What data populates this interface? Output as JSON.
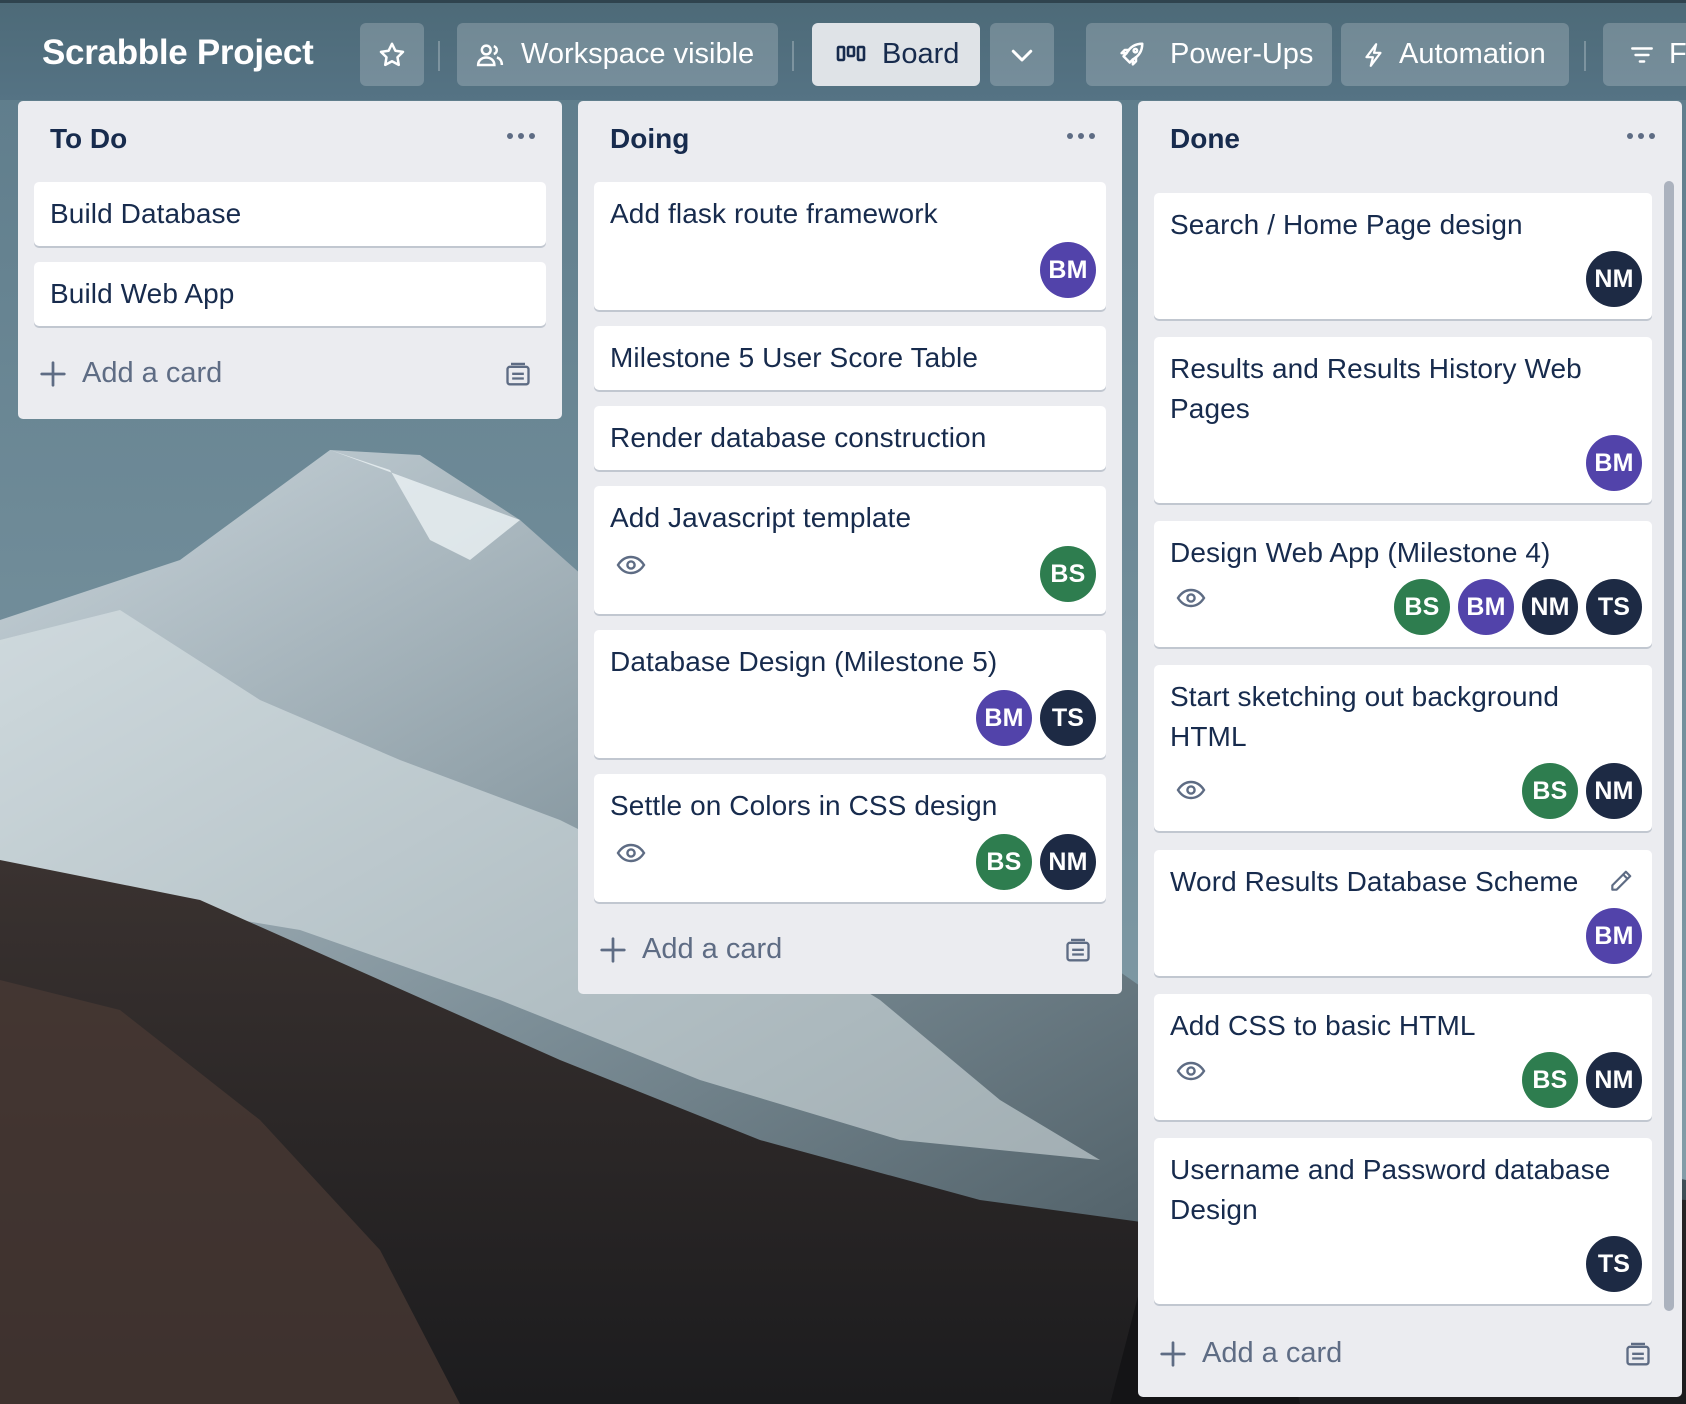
{
  "board": {
    "title": "Scrabble Project",
    "visibility_label": "Workspace visible",
    "view_label": "Board",
    "powerups_label": "Power-Ups",
    "automation_label": "Automation",
    "filter_label_partial": "F"
  },
  "colors": {
    "header_bg": "#557384",
    "list_bg": "#ebecf0",
    "card_bg": "#ffffff",
    "text_primary": "#172b4d",
    "text_muted": "#5e6c84",
    "avatar_BM": "#5243aa",
    "avatar_BS": "#2e7d4f",
    "avatar_NM": "#1d2a44",
    "avatar_TS": "#1d2a44"
  },
  "lists": [
    {
      "title": "To Do",
      "add_card_label": "Add a card",
      "cards": [
        {
          "title": "Build Database"
        },
        {
          "title": "Build Web App"
        }
      ]
    },
    {
      "title": "Doing",
      "add_card_label": "Add a card",
      "cards": [
        {
          "title": "Add flask route framework",
          "members": [
            "BM"
          ]
        },
        {
          "title": "Milestone 5 User Score Table"
        },
        {
          "title": "Render database construction"
        },
        {
          "title": "Add Javascript template",
          "watching": true,
          "members": [
            "BS"
          ]
        },
        {
          "title": "Database Design (Milestone 5)",
          "members": [
            "BM",
            "TS"
          ]
        },
        {
          "title": "Settle on Colors in CSS design",
          "watching": true,
          "members": [
            "BS",
            "NM"
          ]
        }
      ]
    },
    {
      "title": "Done",
      "add_card_label": "Add a card",
      "cards": [
        {
          "title": "Search / Home Page design",
          "members": [
            "NM"
          ]
        },
        {
          "title": "Results and Results History Web Pages",
          "members": [
            "BM"
          ]
        },
        {
          "title": "Design Web App (Milestone 4)",
          "watching": true,
          "members": [
            "BS",
            "BM",
            "NM",
            "TS"
          ]
        },
        {
          "title": "Start sketching out background HTML",
          "watching": true,
          "members": [
            "BS",
            "NM"
          ]
        },
        {
          "title": "Word Results Database Scheme",
          "edit_icon": true,
          "members": [
            "BM"
          ]
        },
        {
          "title": "Add CSS to basic HTML",
          "watching": true,
          "members": [
            "BS",
            "NM"
          ]
        },
        {
          "title": "Username and Password database Design",
          "members": [
            "TS"
          ]
        }
      ]
    }
  ]
}
